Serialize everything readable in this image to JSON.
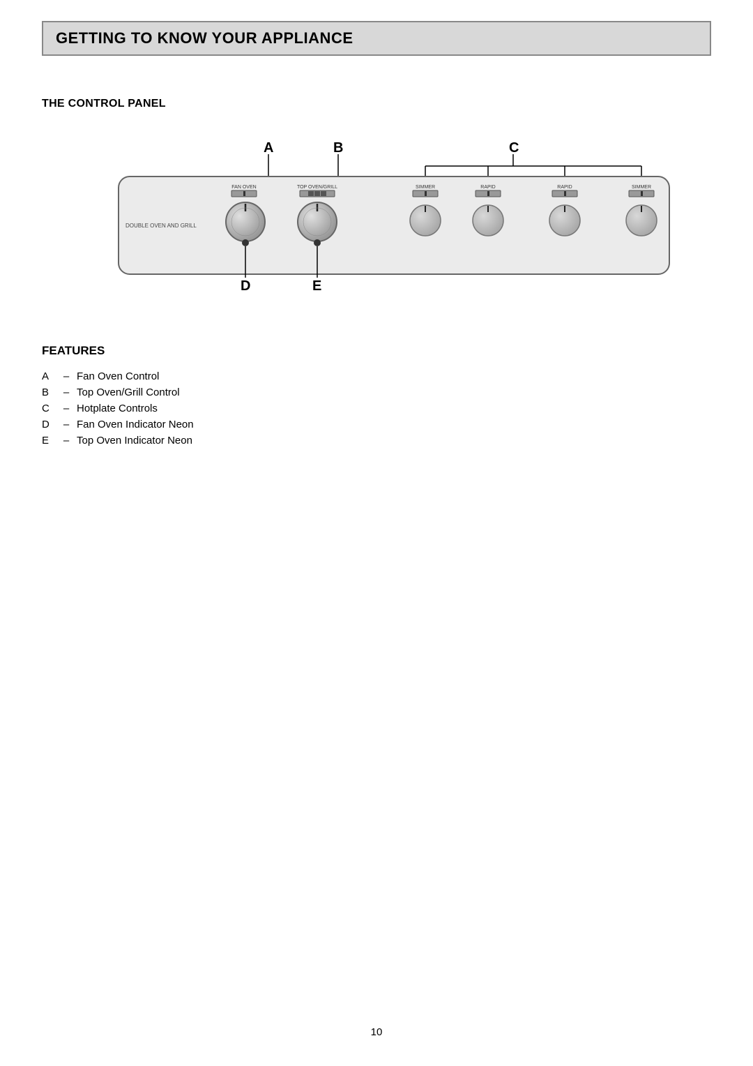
{
  "header": {
    "title": "GETTING TO KNOW YOUR APPLIANCE"
  },
  "sections": {
    "control_panel": {
      "title": "THE CONTROL PANEL",
      "panel_label": "DOUBLE OVEN AND GRILL",
      "knobs": [
        {
          "id": "A",
          "label": "FAN OVEN",
          "type": "oven",
          "has_indicator": true
        },
        {
          "id": "B",
          "label": "TOP OVEN/GRILL",
          "type": "oven",
          "has_indicator": true
        },
        {
          "id": "C1",
          "label": "SIMMER",
          "type": "hob",
          "has_indicator": false
        },
        {
          "id": "C2",
          "label": "RAPID",
          "type": "hob",
          "has_indicator": false
        },
        {
          "id": "C3",
          "label": "RAPID",
          "type": "hob",
          "has_indicator": false
        },
        {
          "id": "C4",
          "label": "SIMMER",
          "type": "hob",
          "has_indicator": false
        }
      ],
      "labels": {
        "A": "A",
        "B": "B",
        "C": "C",
        "D": "D",
        "E": "E"
      }
    },
    "features": {
      "title": "FEATURES",
      "items": [
        {
          "key": "A",
          "dash": "–",
          "description": "Fan Oven Control"
        },
        {
          "key": "B",
          "dash": "–",
          "description": "Top Oven/Grill Control"
        },
        {
          "key": "C",
          "dash": "–",
          "description": "Hotplate Controls"
        },
        {
          "key": "D",
          "dash": "–",
          "description": "Fan Oven Indicator Neon"
        },
        {
          "key": "E",
          "dash": "–",
          "description": "Top Oven Indicator Neon"
        }
      ]
    }
  },
  "footer": {
    "page_number": "10"
  }
}
